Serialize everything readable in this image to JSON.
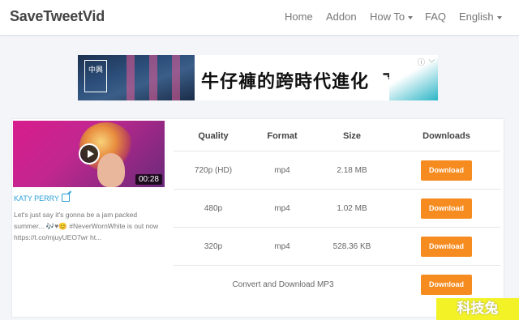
{
  "navbar": {
    "brand": "SaveTweetVid",
    "items": [
      "Home",
      "Addon",
      "How To",
      "FAQ",
      "English"
    ]
  },
  "ad": {
    "headline": "牛仔褲的跨時代進化",
    "logo_text": "中興",
    "info_icon": "info-icon",
    "close_icon": "close-icon"
  },
  "video": {
    "duration": "00:28",
    "author": "KATY PERRY",
    "description": "Let's just say it's gonna be a jam packed summer... 🎶♥😊 #NeverWornWhite is out now https://t.co/mjuyUEO7wr ht..."
  },
  "table": {
    "headers": [
      "Quality",
      "Format",
      "Size",
      "Downloads"
    ],
    "rows": [
      {
        "quality": "720p (HD)",
        "format": "mp4",
        "size": "2.18 MB",
        "button": "Download"
      },
      {
        "quality": "480p",
        "format": "mp4",
        "size": "1.02 MB",
        "button": "Download"
      },
      {
        "quality": "320p",
        "format": "mp4",
        "size": "528.36 KB",
        "button": "Download"
      }
    ],
    "mp3_row": {
      "label": "Convert and Download MP3",
      "button": "Download"
    }
  },
  "colors": {
    "accent": "#f68b1f",
    "link": "#2a9fd6"
  },
  "watermark": "科技兔"
}
